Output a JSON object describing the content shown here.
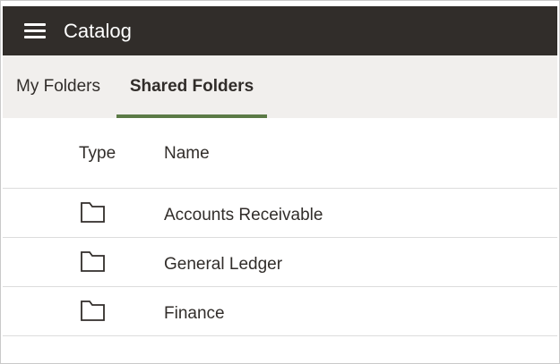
{
  "header": {
    "title": "Catalog",
    "menu_icon": "hamburger-menu-icon",
    "background": "#312d2a"
  },
  "tabs": [
    {
      "label": "My Folders",
      "selected": false
    },
    {
      "label": "Shared Folders",
      "selected": true
    }
  ],
  "accent_color": "#5b7a46",
  "table": {
    "columns": [
      "Type",
      "Name"
    ],
    "rows": [
      {
        "type_icon": "folder-icon",
        "name": "Accounts Receivable"
      },
      {
        "type_icon": "folder-icon",
        "name": "General Ledger"
      },
      {
        "type_icon": "folder-icon",
        "name": "Finance"
      }
    ]
  }
}
